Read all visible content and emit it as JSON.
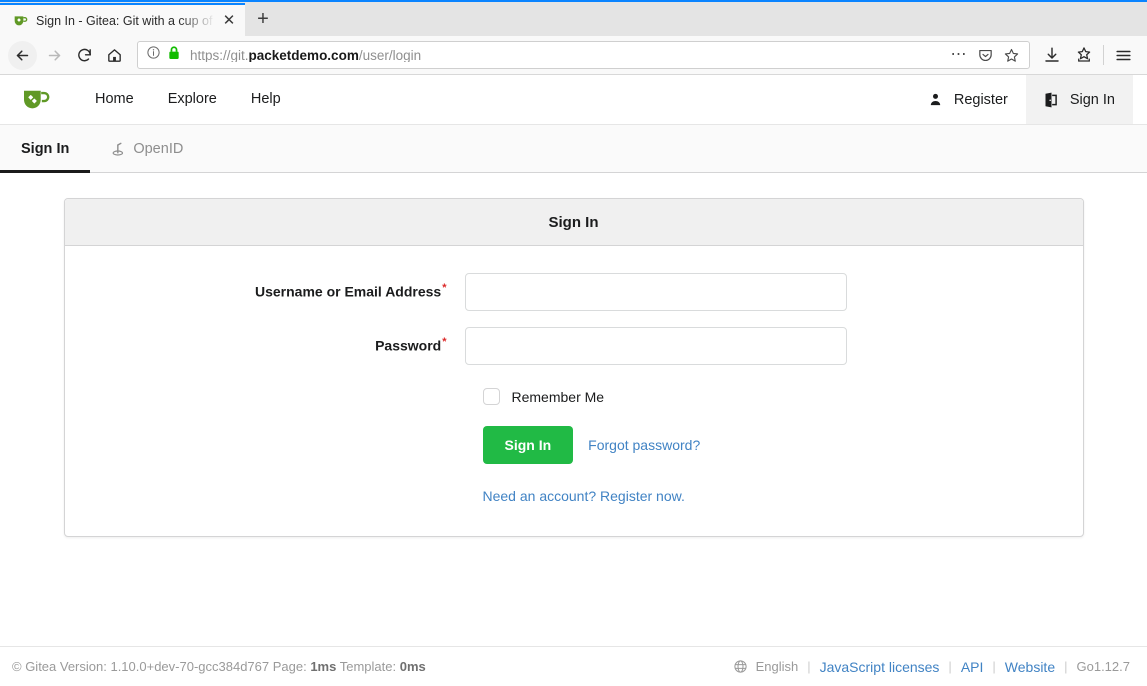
{
  "browser": {
    "tab": {
      "title": "Sign In - Gitea: Git with a cup of tea",
      "favicon_name": "gitea-favicon",
      "close_label": "✕"
    },
    "newtab_label": "+",
    "nav": {
      "back_label": "Back",
      "forward_label": "Forward",
      "reload_label": "Reload",
      "home_label": "Home"
    },
    "url": {
      "scheme": "https://git.",
      "domain": "packetdemo.com",
      "path": "/user/login",
      "identity_icon": "page-info-icon",
      "lock_icon": "lock-icon",
      "lock_color": "#12bc00"
    },
    "url_actions": [
      "page-actions-icon",
      "pocket-icon",
      "bookmark-star-icon"
    ],
    "toolbar_icons": [
      "downloads-icon",
      "library-icon",
      "app-menu-icon"
    ]
  },
  "site": {
    "nav": {
      "logo_name": "gitea-logo",
      "items": [
        {
          "label": "Home"
        },
        {
          "label": "Explore"
        },
        {
          "label": "Help"
        }
      ],
      "register": {
        "label": "Register",
        "icon": "user-icon"
      },
      "signin": {
        "label": "Sign In",
        "icon": "sign-in-icon"
      }
    },
    "tabs": [
      {
        "label": "Sign In",
        "active": true,
        "icon": null
      },
      {
        "label": "OpenID",
        "active": false,
        "icon": "openid-icon"
      }
    ],
    "form": {
      "card_title": "Sign In",
      "username": {
        "label": "Username or Email Address",
        "required_marker": "*",
        "value": "",
        "placeholder": ""
      },
      "password": {
        "label": "Password",
        "required_marker": "*",
        "value": "",
        "placeholder": ""
      },
      "remember_me_label": "Remember Me",
      "submit_label": "Sign In",
      "forgot_password_label": "Forgot password?",
      "register_prompt_label": "Need an account? Register now.",
      "accent_green": "#21ba45",
      "link_blue": "#4183c4",
      "required_red": "#db2828"
    },
    "footer": {
      "copyright": "© Gitea Version: 1.10.0+dev-70-gcc384d767 Page:",
      "page_time": "1ms",
      "template_label": "Template:",
      "template_time": "0ms",
      "language_icon": "globe-icon",
      "language": "English",
      "separator": "|",
      "links": [
        {
          "label": "JavaScript licenses"
        },
        {
          "label": "API"
        },
        {
          "label": "Website"
        }
      ],
      "go_version": "Go1.12.7"
    }
  }
}
